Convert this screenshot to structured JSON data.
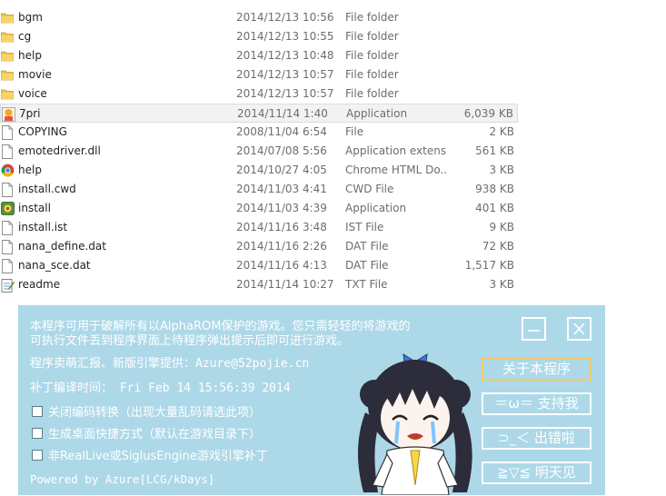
{
  "files": [
    {
      "name": "bgm",
      "date": "2014/12/13 10:56",
      "type": "File folder",
      "size": "",
      "icon": "folder"
    },
    {
      "name": "cg",
      "date": "2014/12/13 10:55",
      "type": "File folder",
      "size": "",
      "icon": "folder"
    },
    {
      "name": "help",
      "date": "2014/12/13 10:48",
      "type": "File folder",
      "size": "",
      "icon": "folder"
    },
    {
      "name": "movie",
      "date": "2014/12/13 10:57",
      "type": "File folder",
      "size": "",
      "icon": "folder"
    },
    {
      "name": "voice",
      "date": "2014/12/13 10:57",
      "type": "File folder",
      "size": "",
      "icon": "folder"
    },
    {
      "name": "7pri",
      "date": "2014/11/14 1:40",
      "type": "Application",
      "size": "6,039 KB",
      "icon": "app-character"
    },
    {
      "name": "COPYING",
      "date": "2008/11/04 6:54",
      "type": "File",
      "size": "2 KB",
      "icon": "file"
    },
    {
      "name": "emotedriver.dll",
      "date": "2014/07/08 5:56",
      "type": "Application extens...",
      "size": "561 KB",
      "icon": "file"
    },
    {
      "name": "help",
      "date": "2014/10/27 4:05",
      "type": "Chrome HTML Do...",
      "size": "3 KB",
      "icon": "chrome"
    },
    {
      "name": "install.cwd",
      "date": "2014/11/03 4:41",
      "type": "CWD File",
      "size": "938 KB",
      "icon": "file"
    },
    {
      "name": "install",
      "date": "2014/11/03 4:39",
      "type": "Application",
      "size": "401 KB",
      "icon": "installer"
    },
    {
      "name": "install.ist",
      "date": "2014/11/16 3:48",
      "type": "IST File",
      "size": "9 KB",
      "icon": "file"
    },
    {
      "name": "nana_define.dat",
      "date": "2014/11/16 2:26",
      "type": "DAT File",
      "size": "72 KB",
      "icon": "file"
    },
    {
      "name": "nana_sce.dat",
      "date": "2014/11/16 4:13",
      "type": "DAT File",
      "size": "1,517 KB",
      "icon": "file"
    },
    {
      "name": "readme",
      "date": "2014/11/14 10:27",
      "type": "TXT File",
      "size": "3 KB",
      "icon": "notepad"
    }
  ],
  "dialog": {
    "intro_line1": "本程序可用于破解所有以AlphaROM保护的游戏。您只需轻轻的将游戏的",
    "intro_line2": "可执行文件丢到程序界面上待程序弹出提示后即可进行游戏。",
    "contact": "程序卖萌汇报、新版引擎提供：Azure@52pojie.cn",
    "build_time": "补丁编译时间： Fri Feb 14 15:56:39 2014",
    "options": [
      {
        "label": "关闭编码转换（出现大量乱码请选此项）",
        "checked": false
      },
      {
        "label": "生成桌面快捷方式（默认在游戏目录下）",
        "checked": false
      },
      {
        "label": "非RealLive或SiglusEngine游戏引擎补丁",
        "checked": false
      }
    ],
    "footer": "Powered by Azure[LCG/kDays]",
    "buttons": {
      "about": "关于本程序",
      "support": "＝ω＝ 支持我",
      "error": "⊃_＜ 出错啦",
      "tomorrow": "≧▽≦ 明天见"
    }
  },
  "colors": {
    "dialog_bg": "#add8e8",
    "button_focus": "#f2c86a",
    "text": "#ffffff"
  }
}
